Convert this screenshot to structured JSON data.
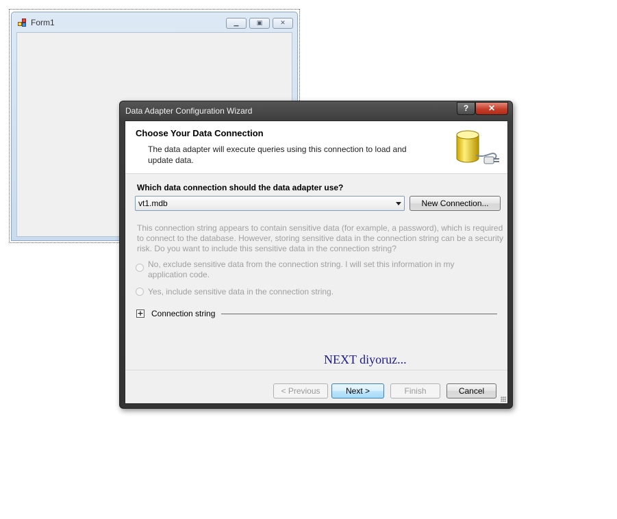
{
  "form1": {
    "title": "Form1",
    "icon": "form-icon",
    "buttons": [
      "minimize-icon",
      "maximize-icon",
      "close-icon"
    ]
  },
  "wizard": {
    "title": "Data Adapter Configuration Wizard",
    "caption_help": "?",
    "caption_close": "✕",
    "header": {
      "title": "Choose Your Data Connection",
      "description": "The data adapter will execute queries using this connection to load and update data.",
      "icon": "database-plug-icon"
    },
    "question": "Which data connection should the data adapter use?",
    "connection_select": {
      "value": "vt1.mdb"
    },
    "new_connection_label": "New Connection...",
    "sensitive_text": "This connection string appears to contain sensitive data (for example, a password), which is required to connect to the database. However, storing sensitive data in the connection string can be a security risk. Do you want to include this sensitive data in the connection string?",
    "radio_exclude": "No, exclude sensitive data from the connection string. I will set this information in my application code.",
    "radio_include": "Yes, include sensitive data in the connection string.",
    "expander_symbol": "+",
    "connection_string_label": "Connection string",
    "annotation": "NEXT diyoruz...",
    "buttons": {
      "previous": "< Previous",
      "next": "Next >",
      "finish": "Finish",
      "cancel": "Cancel"
    }
  },
  "colors": {
    "annotation": "#1b1b8a",
    "disabled_text": "#a0a0a0",
    "close_button": "#c53e2a"
  }
}
